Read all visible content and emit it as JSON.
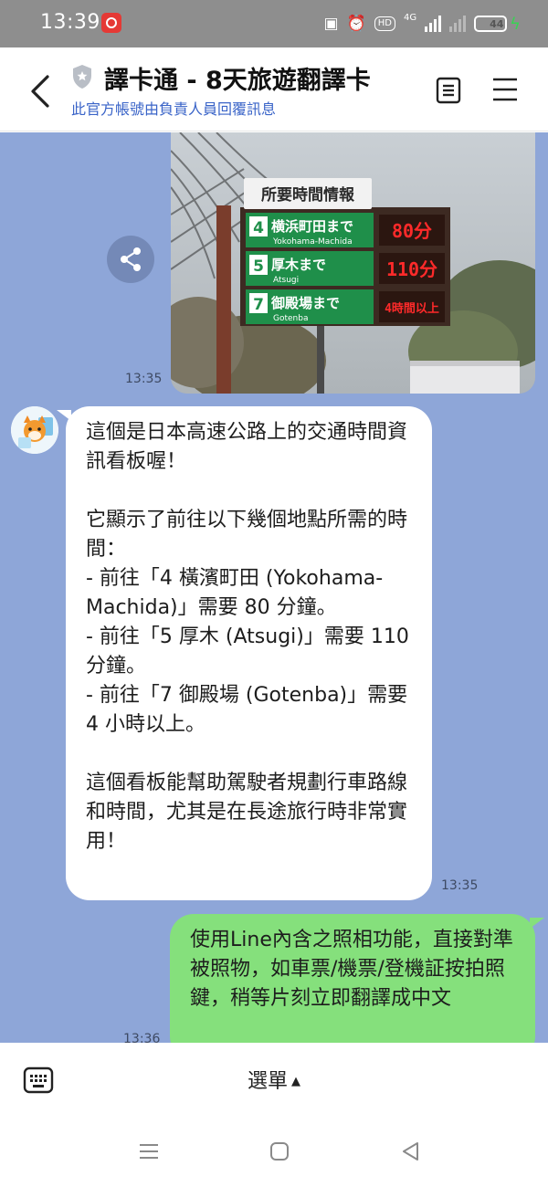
{
  "status_bar": {
    "time": "13:39",
    "network": "4G",
    "battery": "44",
    "battery_level": 0.44,
    "icons": [
      "app-notification-icon",
      "nfc-icon",
      "alarm-icon",
      "hd-icon",
      "signal-icon",
      "battery-icon",
      "charging-icon"
    ]
  },
  "header": {
    "title": "譯卡通 - 8天旅遊翻譯卡",
    "subtitle": "此官方帳號由負責人員回覆訊息"
  },
  "messages": [
    {
      "type": "image",
      "from": "me",
      "time": "13:35",
      "sign": {
        "heading": "所要時間情報",
        "rows": [
          {
            "num": "4",
            "name": "横浜町田まで",
            "romaji": "Yokohama-Machida",
            "value": "80分"
          },
          {
            "num": "5",
            "name": "厚木まで",
            "romaji": "Atsugi",
            "value": "110分"
          },
          {
            "num": "7",
            "name": "御殿場まで",
            "romaji": "Gotenba",
            "value": "4時間以上"
          }
        ]
      }
    },
    {
      "type": "text",
      "from": "bot",
      "time": "13:35",
      "paragraphs": [
        "這個是日本高速公路上的交通時間資訊看板喔！",
        "它顯示了前往以下幾個地點所需的時間：\n- 前往「4 橫濱町田 (Yokohama-Machida)」需要 80 分鐘。\n- 前往「5 厚木 (Atsugi)」需要 110 分鐘。\n- 前往「7 御殿場 (Gotenba)」需要 4 小時以上。",
        "這個看板能幫助駕駛者規劃行車路線和時間，尤其是在長途旅行時非常實用！"
      ]
    },
    {
      "type": "text",
      "from": "me",
      "time": "13:36",
      "text": "使用Line內含之照相功能，直接對準被照物，如車票/機票/登機証按拍照鍵，稍等片刻立即翻譯成中文"
    }
  ],
  "bottom_bar": {
    "menu_label": "選單"
  },
  "colors": {
    "chat_background": "#8ea6d8",
    "outgoing_bubble": "#85e07c",
    "incoming_bubble": "#ffffff",
    "subtitle_link": "#3a64c8",
    "sign_green": "#1f8f4a",
    "sign_led": "#ff2a2a"
  }
}
